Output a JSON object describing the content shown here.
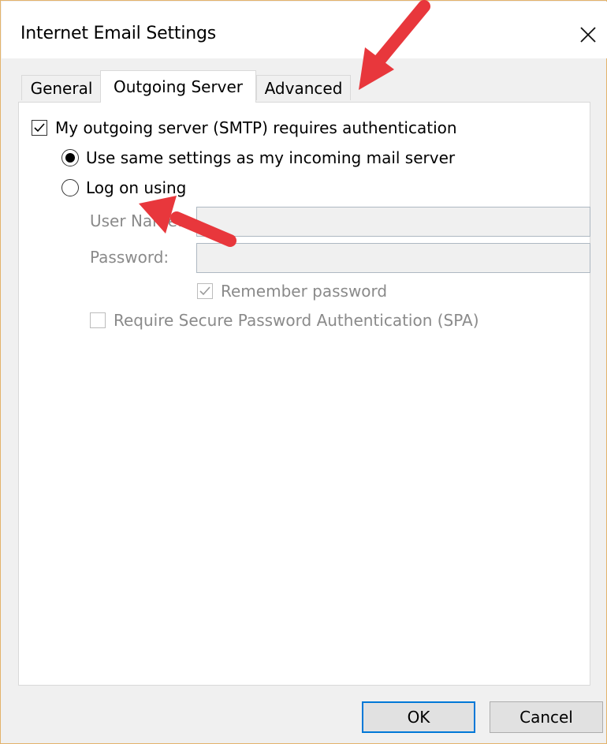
{
  "window": {
    "title": "Internet Email Settings",
    "close_icon": "close-icon"
  },
  "tabs": [
    {
      "label": "General",
      "active": false
    },
    {
      "label": "Outgoing Server",
      "active": true
    },
    {
      "label": "Advanced",
      "active": false
    }
  ],
  "outgoing": {
    "smtp_auth_label": "My outgoing server (SMTP) requires authentication",
    "smtp_auth_checked": true,
    "radio_same_label": "Use same settings as my incoming mail server",
    "radio_same_selected": true,
    "radio_logon_label": "Log on using",
    "radio_logon_selected": false,
    "user_name_label": "User Name:",
    "user_name_value": "",
    "password_label": "Password:",
    "password_value": "",
    "remember_password_label": "Remember password",
    "remember_password_checked": true,
    "spa_label": "Require Secure Password Authentication (SPA)",
    "spa_checked": false
  },
  "buttons": {
    "ok": "OK",
    "cancel": "Cancel"
  },
  "annotations": {
    "arrow_color": "#e8373c"
  }
}
